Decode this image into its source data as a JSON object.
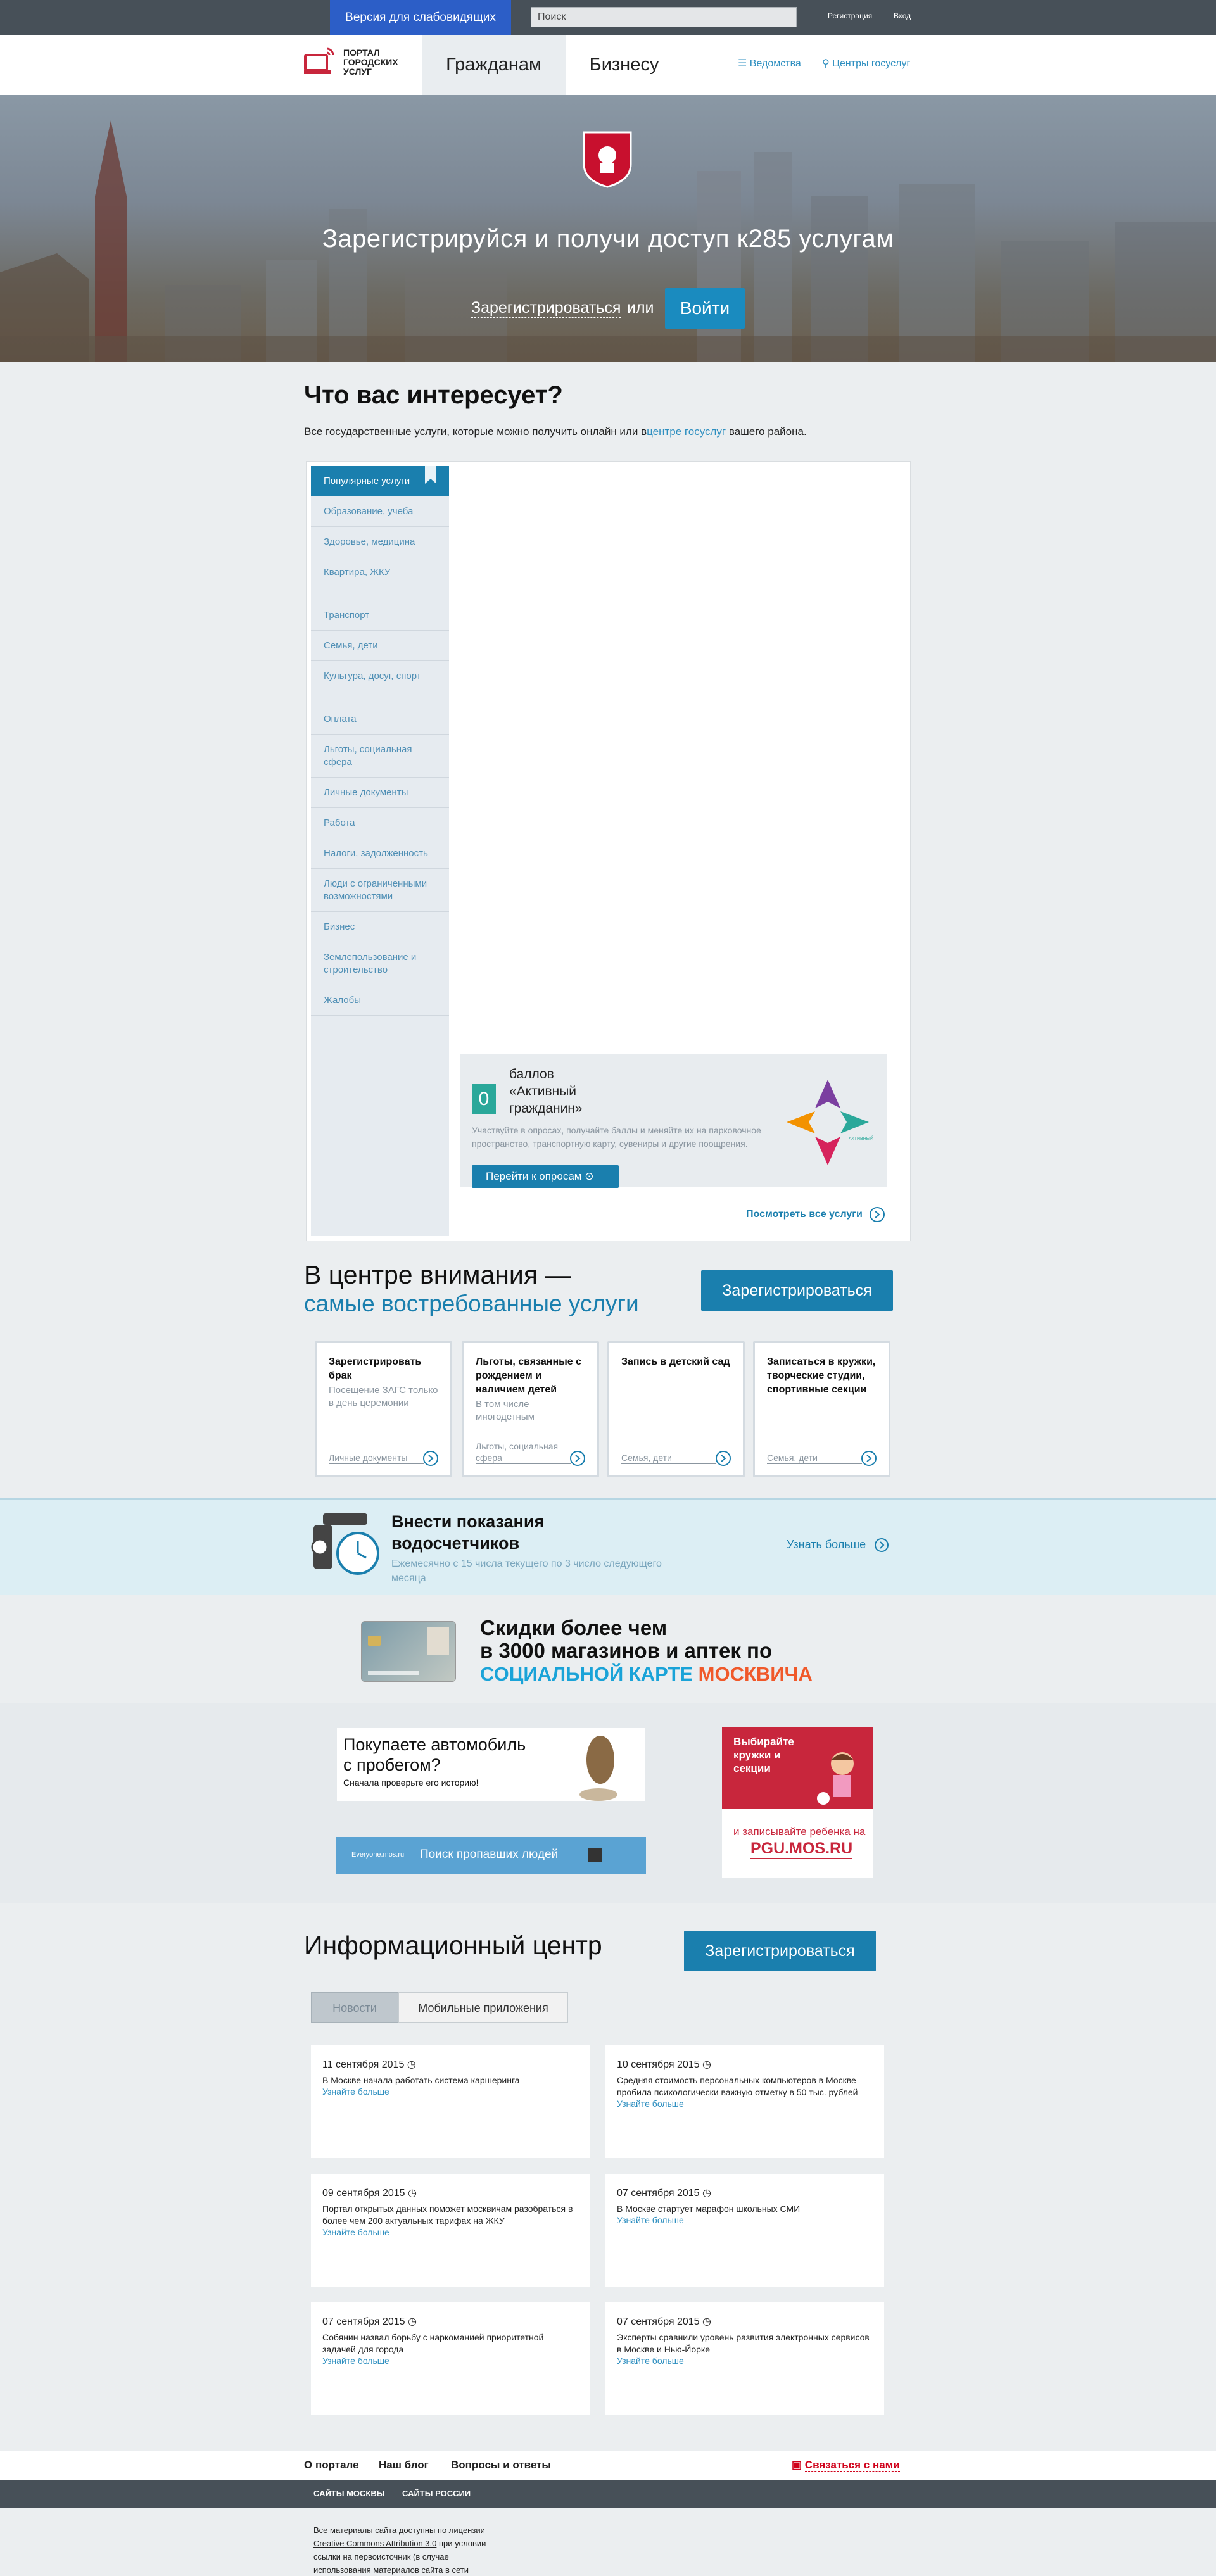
{
  "topbar": {
    "vision_label": "Версия для слабовидящих",
    "search_placeholder": "Поиск",
    "register_label": "Регистрация",
    "login_label": "Вход"
  },
  "header": {
    "logo_text": "ПОРТАЛ ГОРОДСКИХ УСЛУГ",
    "tab_citizens": "Гражданам",
    "tab_business": "Бизнесу",
    "link_departments": "Ведомства",
    "link_centers": "Центры госуслуг"
  },
  "hero": {
    "title_before": "Зарегистрируйся и получи доступ к",
    "title_link": "285 услугам",
    "register_link": "Зарегистрироваться",
    "or_text": "или",
    "login_button": "Войти"
  },
  "interest": {
    "heading": "Что вас интересует?",
    "subtitle_before": "Все государственные услуги, которые можно получить онлайн или в",
    "subtitle_link": "центре госуслуг",
    "subtitle_after": " вашего района.",
    "categories": [
      "Популярные услуги",
      "Образование, учеба",
      "Здоровье, медицина",
      "Квартира, ЖКУ",
      "Транспорт",
      "Семья, дети",
      "Культура, досуг, спорт",
      "Оплата",
      "Льготы, социальная сфера",
      "Личные документы",
      "Работа",
      "Налоги, задолженность",
      "Люди с ограниченными возможностями",
      "Бизнес",
      "Землепользование и строительство",
      "Жалобы"
    ],
    "active_citizen": {
      "points": "0",
      "title": "баллов «Активный гражданин»",
      "description": "Участвуйте в опросах, получайте баллы и меняйте их на парковочное пространство, транспортную карту, сувениры и другие поощрения.",
      "button": "Перейти к опросам",
      "logo_caption": "АКТИВНЫЙ ГРАЖДАНИН"
    },
    "see_all": "Посмотреть все услуги"
  },
  "focus": {
    "title_line1": "В центре внимания —",
    "title_line2": "самые востребованные услуги",
    "register_button": "Зарегистрироваться",
    "cards": [
      {
        "title": "Зарегистрировать брак",
        "subtitle": "Посещение ЗАГС только в день церемонии",
        "category": "Личные документы"
      },
      {
        "title": "Льготы, связанные с рождением и наличием детей",
        "subtitle": "В том числе многодетным",
        "category": "Льготы, социальная сфера"
      },
      {
        "title": "Запись в детский сад",
        "subtitle": "",
        "category": "Семья, дети"
      },
      {
        "title": "Записаться в кружки, творческие студии, спортивные секции",
        "subtitle": "",
        "category": "Семья, дети"
      }
    ]
  },
  "water": {
    "title": "Внести показания водосчетчиков",
    "subtitle": "Ежемесячно с 15 числа текущего по 3 число следующего месяца",
    "more": "Узнать больше"
  },
  "social_card": {
    "line1": "Скидки более чем",
    "line2": "в 3000 магазинов и аптек по",
    "line3_a": "СОЦИАЛЬНОЙ КАРТЕ ",
    "line3_b": "МОСКВИЧА",
    "colors": {
      "blue": "#1aa3d8",
      "green": "#2aa84a",
      "orange": "#f0592a"
    }
  },
  "ads": {
    "car_title": "Покупаете автомобиль с пробегом?",
    "car_sub": "Сначала проверьте его историю!",
    "missing_label": "Поиск пропавших людей",
    "missing_site": "Everyone.mos.ru",
    "kids_title": "Выбирайте кружки и секции",
    "kids_sub": "и записывайте ребенка на",
    "kids_site": "PGU.MOS.RU"
  },
  "info": {
    "heading": "Информационный центр",
    "register_button": "Зарегистрироваться",
    "tabs": [
      "Новости",
      "Мобильные приложения"
    ],
    "more_label": "Узнайте больше",
    "news": [
      {
        "date": "11 сентября 2015",
        "text": "В Москве начала работать система каршеринга"
      },
      {
        "date": "10 сентября 2015",
        "text": "Средняя стоимость персональных компьютеров в Москве пробила психологически важную отметку в 50 тыс. рублей"
      },
      {
        "date": "09 сентября 2015",
        "text": "Портал открытых данных поможет москвичам разобраться в более чем 200 актуальных тарифах на ЖКУ"
      },
      {
        "date": "07 сентября 2015",
        "text": "В Москве стартует марафон школьных СМИ"
      },
      {
        "date": "07 сентября 2015",
        "text": "Собянин назвал борьбу с наркоманией приоритетной задачей для города"
      },
      {
        "date": "07 сентября 2015",
        "text": "Эксперты сравнили уровень развития электронных сервисов в Москве и Нью-Йорке"
      }
    ]
  },
  "footer": {
    "nav": [
      "О портале",
      "Наш блог",
      "Вопросы и ответы"
    ],
    "contact": "Связаться с нами",
    "sites": [
      "САЙТЫ МОСКВЫ",
      "САЙТЫ РОССИИ"
    ],
    "license_before": "Все материалы сайта доступны по лицензии ",
    "license_link": "Creative Commons Attribution 3.0",
    "license_after": " при условии ссылки на первоисточник (в случае использования материалов сайта в сети"
  }
}
